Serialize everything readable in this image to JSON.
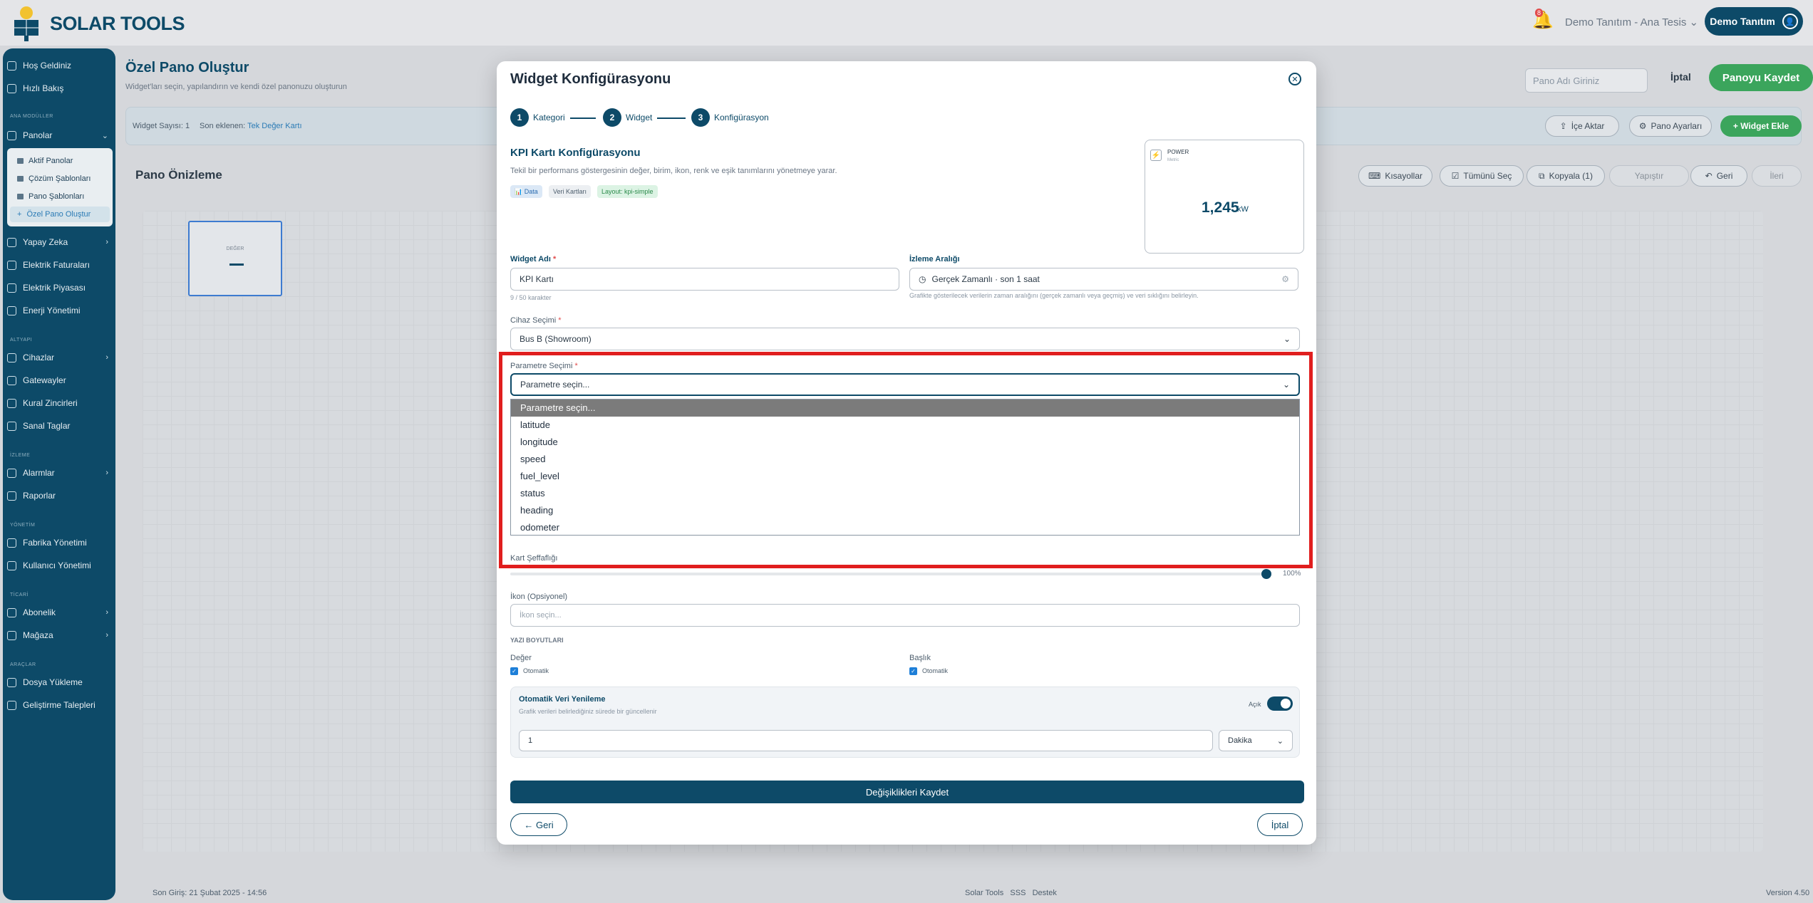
{
  "app": {
    "logo_text": "SOLAR TOOLS",
    "notifications": "8",
    "facility": "Demo Tanıtım - Ana Tesis",
    "user": "Demo Tanıtım"
  },
  "sidebar": {
    "top": [
      {
        "label": "Hoş Geldiniz"
      },
      {
        "label": "Hızlı Bakış"
      }
    ],
    "section_main": "ANA MODÜLLER",
    "panels": "Panolar",
    "panel_sub": [
      "Aktif Panolar",
      "Çözüm Şablonları",
      "Pano Şablonları",
      "Özel Pano Oluştur"
    ],
    "main": [
      "Yapay Zeka",
      "Elektrik Faturaları",
      "Elektrik Piyasası",
      "Enerji Yönetimi"
    ],
    "section_infra": "ALTYAPI",
    "infra": [
      "Cihazlar",
      "Gatewayler",
      "Kural Zincirleri",
      "Sanal Taglar"
    ],
    "section_mon": "İZLEME",
    "mon": [
      "Alarmlar",
      "Raporlar"
    ],
    "section_admin": "YÖNETİM",
    "admin": [
      "Fabrika Yönetimi",
      "Kullanıcı Yönetimi"
    ],
    "section_com": "TİCARİ",
    "com": [
      "Abonelik",
      "Mağaza"
    ],
    "section_tools": "ARAÇLAR",
    "tools": [
      "Dosya Yükleme",
      "Geliştirme Talepleri"
    ]
  },
  "main": {
    "title": "Özel Pano Oluştur",
    "subtitle": "Widget'ları seçin, yapılandırın ve kendi özel panonuzu oluşturun",
    "name_placeholder": "Pano Adı Giriniz",
    "cancel": "İptal",
    "save": "Panoyu Kaydet",
    "widget_count": "Widget Sayısı: 1",
    "last_added_label": "Son eklenen:",
    "last_added": "Tek Değer Kartı",
    "import": "İçe Aktar",
    "settings": "Pano Ayarları",
    "add_widget": "+ Widget Ekle",
    "preview_title": "Pano Önizleme",
    "shortcuts": "Kısayollar",
    "select_all": "Tümünü Seç",
    "copy": "Kopyala (1)",
    "paste": "Yapıştır",
    "back": "Geri",
    "forward": "İleri",
    "canvas_box_label": "DEĞER",
    "canvas_box_value": "—"
  },
  "footer": {
    "last_login": "Son Giriş: 21 Şubat 2025 - 14:56",
    "brand": "Solar Tools",
    "faq": "SSS",
    "support": "Destek",
    "version": "Version 4.50"
  },
  "modal": {
    "title": "Widget Konfigürasyonu",
    "steps": [
      {
        "n": "1",
        "label": "Kategori"
      },
      {
        "n": "2",
        "label": "Widget"
      },
      {
        "n": "3",
        "label": "Konfigürasyon"
      }
    ],
    "kpi_title": "KPI Kartı Konfigürasyonu",
    "kpi_desc": "Tekil bir performans göstergesinin değer, birim, ikon, renk ve eşik tanımlarını yönetmeye yarar.",
    "tags": [
      "📊 Data",
      "Veri Kartları",
      "Layout: kpi-simple"
    ],
    "preview": {
      "label": "POWER",
      "sub": "Metric",
      "value": "1,245",
      "unit": "kW"
    },
    "widget_name_label": "Widget Adı",
    "widget_name_value": "KPI Kartı",
    "widget_name_hint": "9 / 50 karakter",
    "interval_label": "İzleme Aralığı",
    "interval_value": "Gerçek Zamanlı · son 1 saat",
    "interval_hint": "Grafikte gösterilecek verilerin zaman aralığını (gerçek zamanlı veya geçmiş) ve veri sıklığını belirleyin.",
    "device_label": "Cihaz Seçimi",
    "device_value": "Bus B (Showroom)",
    "param_label": "Parametre Seçimi",
    "param_value": "Parametre seçin...",
    "options": [
      "Parametre seçin...",
      "latitude",
      "longitude",
      "speed",
      "fuel_level",
      "status",
      "heading",
      "odometer"
    ],
    "opacity_label": "Kart Şeffaflığı",
    "opacity_value": "100%",
    "opacity": 1.0,
    "icon_label": "İkon (Opsiyonel)",
    "icon_placeholder": "İkon seçin...",
    "font_section": "YAZI BOYUTLARI",
    "value_label": "Değer",
    "title_label": "Başlık",
    "auto": "Otomatik",
    "refresh_title": "Otomatik Veri Yenileme",
    "refresh_desc": "Grafik verileri belirlediğiniz sürede bir güncellenir",
    "refresh_on": "Açık",
    "refresh_value": "1",
    "refresh_unit": "Dakika",
    "save_changes": "Değişiklikleri Kaydet",
    "back": "← Geri",
    "cancel": "İptal"
  }
}
